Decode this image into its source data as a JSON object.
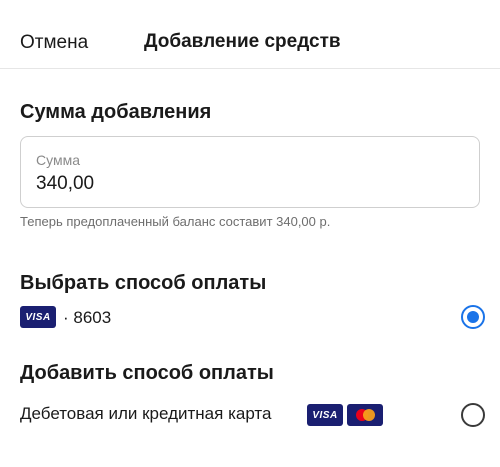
{
  "header": {
    "cancel_label": "Отмена",
    "title": "Добавление средств"
  },
  "amount_section": {
    "title": "Сумма добавления",
    "field_label": "Сумма",
    "field_value": "340,00",
    "helper_text": "Теперь предоплаченный баланс составит 340,00 р."
  },
  "payment_method_section": {
    "title": "Выбрать способ оплаты",
    "saved_card": {
      "brand": "VISA",
      "number_label": "· 8603",
      "selected": true
    }
  },
  "add_method_section": {
    "title": "Добавить способ оплаты",
    "option_label": "Дебетовая или кредитная карта",
    "brands": [
      "VISA",
      "mastercard-icon"
    ],
    "selected": false
  },
  "colors": {
    "accent": "#1a73e8",
    "visa_blue": "#1a1f71",
    "mc_red": "#eb001b",
    "mc_orange": "#f79e1b"
  }
}
